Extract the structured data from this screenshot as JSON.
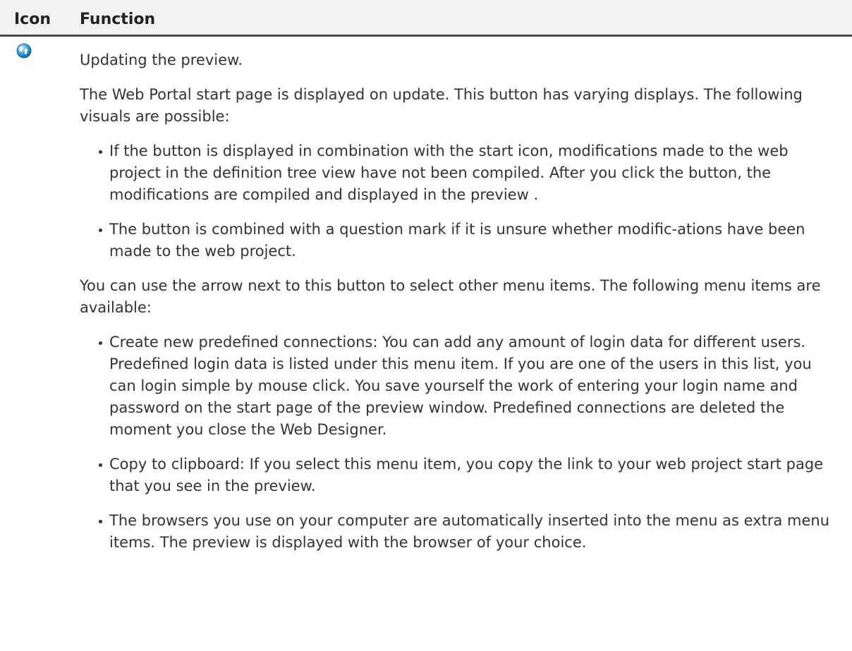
{
  "table": {
    "headers": {
      "icon": "Icon",
      "function": "Function"
    }
  },
  "row": {
    "icon": "globe-refresh-icon",
    "title": "Updating the preview.",
    "para1": "The Web Portal start page is displayed on update. This button has varying displays. The following visuals are possible:",
    "list1": [
      "If the button is displayed in combination with the start icon, modifications made to the web project in the definition tree view have not been compiled. After you click the button, the modifications are compiled and displayed in the preview .",
      "The button is combined with a question mark if it is unsure whether modific-ations have been made to the web project."
    ],
    "para2": "You can use the arrow next to this button to select other menu items. The following menu items are available:",
    "list2": [
      "Create new predefined connections: You can add any amount of login data for different users. Predefined login data is listed under this menu item. If you are one of the users in this list, you can login simple by mouse click. You save yourself the work of entering your login name and password on the start page of the preview window. Predefined connections are deleted the moment you close the Web Designer.",
      "Copy to clipboard: If you select this menu item, you copy the link to your web project start page that you see in the preview.",
      "The browsers you use on your computer are automatically inserted into the menu as extra menu items. The preview is displayed with the browser of your choice."
    ]
  }
}
